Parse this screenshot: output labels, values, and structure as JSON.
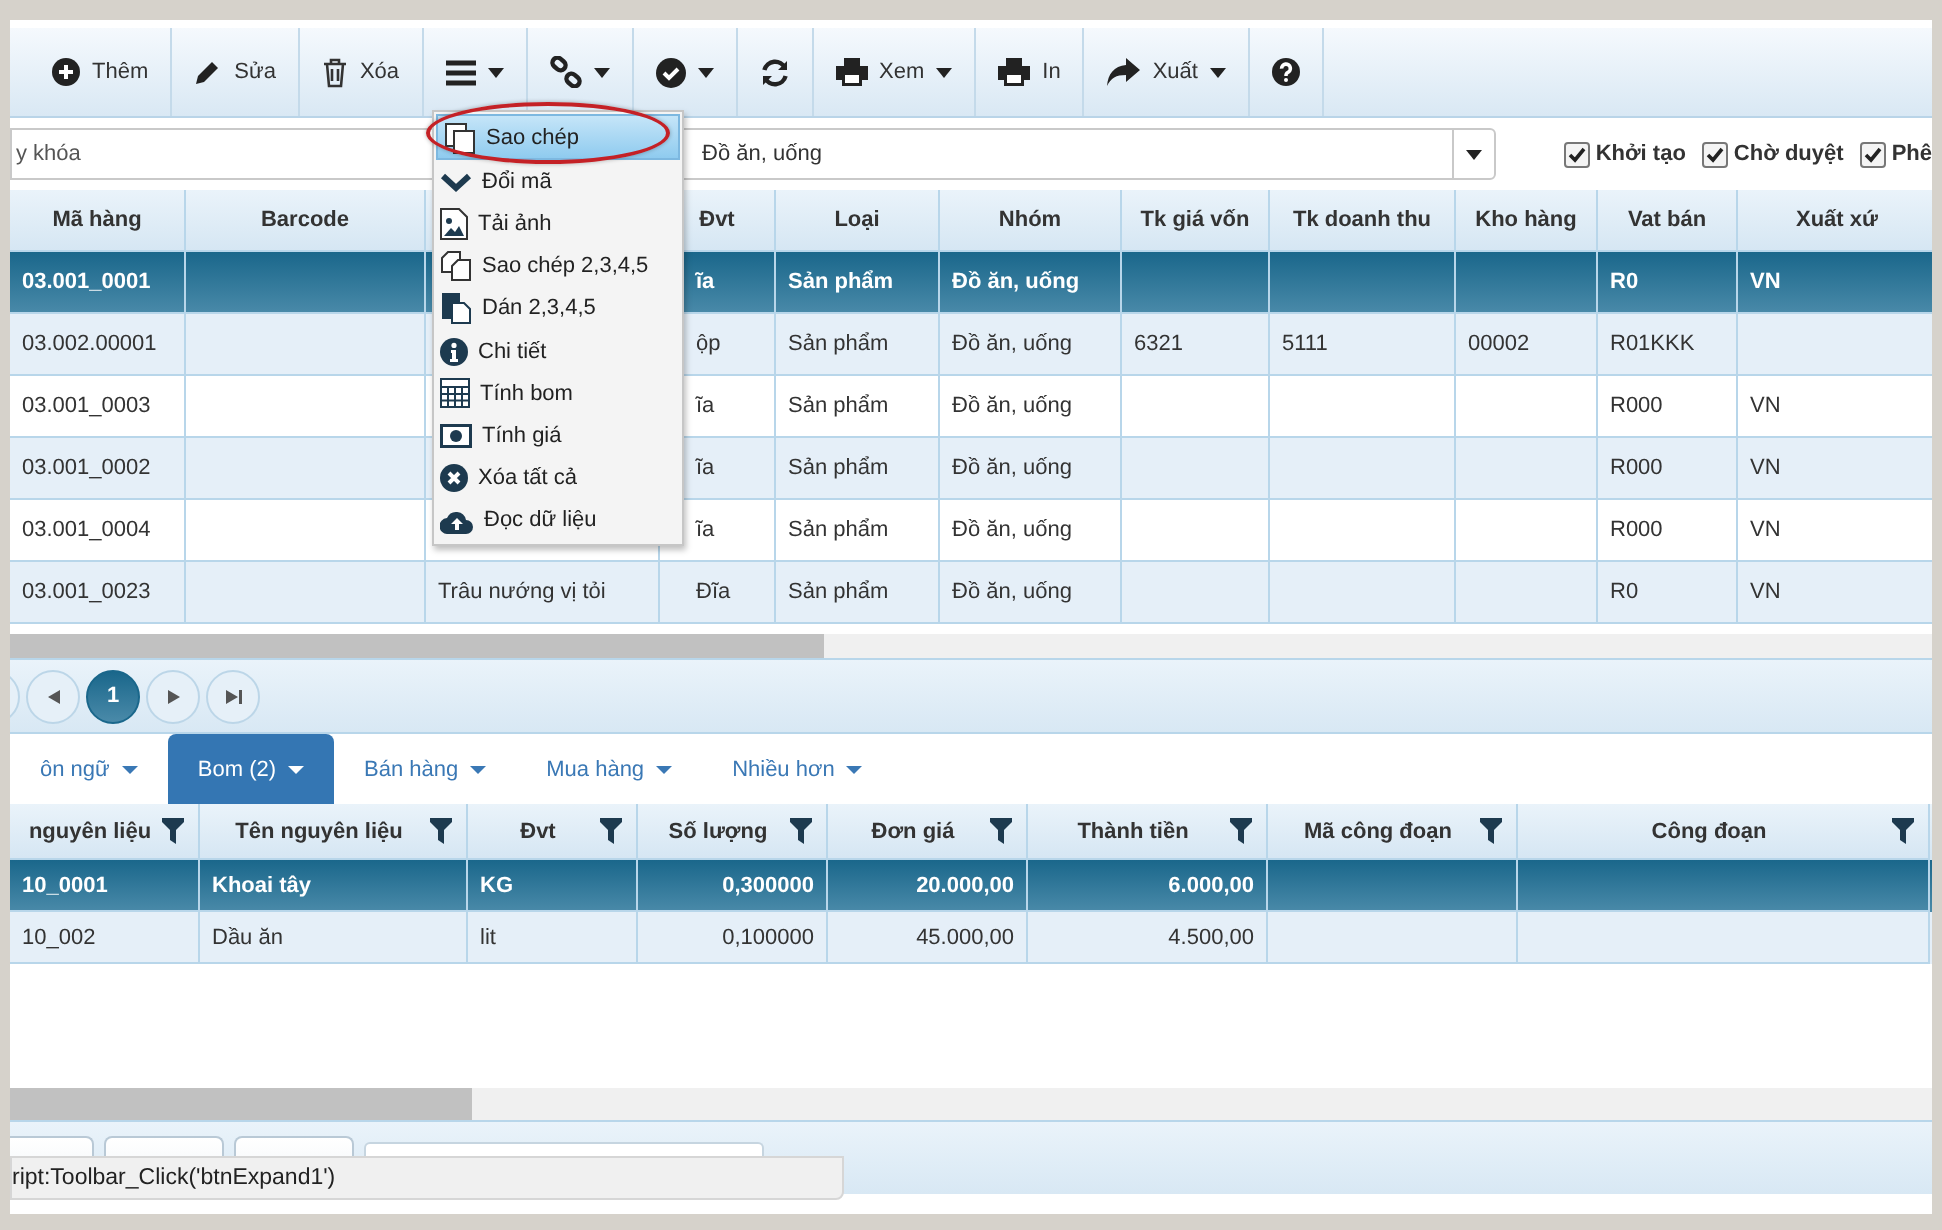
{
  "toolbar": [
    {
      "label": "Thêm",
      "caret": false
    },
    {
      "label": "Sửa",
      "caret": false
    },
    {
      "label": "Xóa",
      "caret": false
    },
    {
      "caret": true
    },
    {
      "caret": true
    },
    {
      "caret": true
    },
    {
      "caret": false
    },
    {
      "label": "Xem",
      "caret": true
    },
    {
      "label": "In",
      "caret": false
    },
    {
      "label": "Xuất",
      "caret": true
    },
    {
      "caret": false
    }
  ],
  "filter": {
    "keyword_placeholder": "y khóa",
    "group_value": "Đồ ăn, uống",
    "statuses": [
      {
        "label": "Khởi tạo",
        "checked": true
      },
      {
        "label": "Chờ duyệt",
        "checked": true
      },
      {
        "label": "Phê",
        "checked": true
      }
    ]
  },
  "menu": {
    "items": [
      {
        "label": "Sao chép",
        "selected": true
      },
      {
        "label": "Đổi mã",
        "selected": false
      },
      {
        "label": "Tải ảnh",
        "selected": false
      },
      {
        "label": "Sao chép 2,3,4,5",
        "selected": false
      },
      {
        "label": "Dán 2,3,4,5",
        "selected": false
      },
      {
        "label": "Chi tiết",
        "selected": false
      },
      {
        "label": "Tính bom",
        "selected": false
      },
      {
        "label": "Tính giá",
        "selected": false
      },
      {
        "label": "Xóa tất cả",
        "selected": false
      },
      {
        "label": "Đọc dữ liệu",
        "selected": false
      }
    ]
  },
  "products": {
    "columns": [
      "Mã hàng",
      "Barcode",
      null,
      "Đvt",
      "Loại",
      "Nhóm",
      "Tk giá vốn",
      "Tk doanh thu",
      "Kho hàng",
      "Vat bán",
      "Xuất xứ"
    ],
    "rows": [
      {
        "selected": true,
        "cells": [
          "03.001_0001",
          null,
          null,
          "ĩa",
          "Sản phẩm",
          "Đồ ăn, uống",
          null,
          null,
          null,
          "R0",
          "VN"
        ]
      },
      {
        "selected": false,
        "cells": [
          "03.002.00001",
          null,
          null,
          "ộp",
          "Sản phẩm",
          "Đồ ăn, uống",
          "6321",
          "5111",
          "00002",
          "R01KKK",
          null
        ]
      },
      {
        "selected": false,
        "cells": [
          "03.001_0003",
          null,
          null,
          "ĩa",
          "Sản phẩm",
          "Đồ ăn, uống",
          null,
          null,
          null,
          "R000",
          "VN"
        ]
      },
      {
        "selected": false,
        "cells": [
          "03.001_0002",
          null,
          null,
          "ĩa",
          "Sản phẩm",
          "Đồ ăn, uống",
          null,
          null,
          null,
          "R000",
          "VN"
        ]
      },
      {
        "selected": false,
        "cells": [
          "03.001_0004",
          null,
          null,
          "ĩa",
          "Sản phẩm",
          "Đồ ăn, uống",
          null,
          null,
          null,
          "R000",
          "VN"
        ]
      },
      {
        "selected": false,
        "cells": [
          "03.001_0023",
          null,
          "Trâu nướng vị tỏi",
          "Đĩa",
          "Sản phẩm",
          "Đồ ăn, uống",
          null,
          null,
          null,
          "R0",
          "VN"
        ]
      }
    ]
  },
  "pager": {
    "pages": [
      {
        "label": "1",
        "selected": true
      }
    ]
  },
  "tabs": [
    {
      "label": "ôn ngữ",
      "selected": false
    },
    {
      "label": "Bom (2)",
      "selected": true
    },
    {
      "label": "Bán hàng",
      "selected": false
    },
    {
      "label": "Mua hàng",
      "selected": false
    },
    {
      "label": "Nhiều hơn",
      "selected": false
    }
  ],
  "bom": {
    "columns": [
      "nguyên liệu",
      "Tên nguyên liệu",
      "Đvt",
      "Số lượng",
      "Đơn giá",
      "Thành tiền",
      "Mã công đoạn",
      "Công đoạn"
    ],
    "rows": [
      {
        "selected": true,
        "cells": [
          "10_0001",
          "Khoai tây",
          "KG",
          "0,300000",
          "20.000,00",
          "6.000,00",
          null,
          null
        ]
      },
      {
        "selected": false,
        "cells": [
          "10_002",
          "Dầu ăn",
          "lit",
          "0,100000",
          "45.000,00",
          "4.500,00",
          null,
          null
        ]
      }
    ]
  },
  "status_bar": "ript:Toolbar_Click('btnExpand1')"
}
